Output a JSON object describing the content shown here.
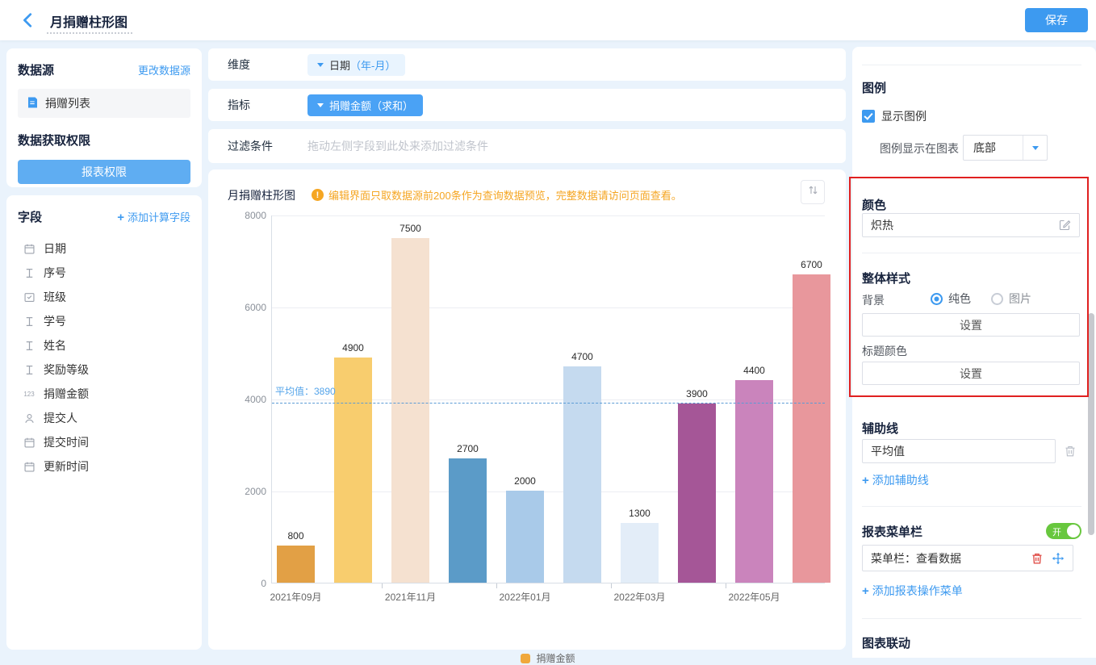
{
  "header": {
    "title": "月捐赠柱形图",
    "save_label": "保存"
  },
  "left_panel": {
    "datasource": {
      "title": "数据源",
      "change_link": "更改数据源",
      "name": "捐赠列表",
      "permission_title": "数据获取权限",
      "permission_button": "报表权限"
    },
    "fields": {
      "title": "字段",
      "add_link": "添加计算字段",
      "items": [
        {
          "icon": "calendar",
          "label": "日期"
        },
        {
          "icon": "text",
          "label": "序号"
        },
        {
          "icon": "select",
          "label": "班级"
        },
        {
          "icon": "text",
          "label": "学号"
        },
        {
          "icon": "text",
          "label": "姓名"
        },
        {
          "icon": "text",
          "label": "奖励等级"
        },
        {
          "icon": "number",
          "label": "捐赠金额"
        },
        {
          "icon": "person",
          "label": "提交人"
        },
        {
          "icon": "calendar",
          "label": "提交时间"
        },
        {
          "icon": "calendar",
          "label": "更新时间"
        }
      ]
    }
  },
  "config_rows": {
    "dimension": {
      "label": "维度",
      "pill_main": "日期",
      "pill_suffix": "（年-月）"
    },
    "metric": {
      "label": "指标",
      "pill": "捐赠金额（求和）"
    },
    "filter": {
      "label": "过滤条件",
      "placeholder": "拖动左侧字段到此处来添加过滤条件"
    }
  },
  "chart_card": {
    "title": "月捐赠柱形图",
    "warning": "编辑界面只取数据源前200条作为查询数据预览，完整数据请访问页面查看。"
  },
  "chart_data": {
    "type": "bar",
    "title": "月捐赠柱形图",
    "values": [
      800,
      4900,
      7500,
      2700,
      2000,
      4700,
      1300,
      3900,
      4400,
      6700
    ],
    "bar_colors": [
      "#E2A045",
      "#F8CD6E",
      "#F5E1D0",
      "#5B9BC8",
      "#A9CAE9",
      "#C5DAEF",
      "#E3EDF8",
      "#A55697",
      "#CA84BC",
      "#E8979C"
    ],
    "ylim": [
      0,
      8000
    ],
    "yticks": [
      0,
      2000,
      4000,
      6000,
      8000
    ],
    "x_tick_labels": [
      "2021年09月",
      "2021年11月",
      "2022年01月",
      "2022年03月",
      "2022年05月"
    ],
    "x_tick_bar_index": [
      0,
      2,
      4,
      6,
      8
    ],
    "average_line": {
      "value": 3890,
      "label": "平均值：3890"
    },
    "legend": [
      {
        "label": "捐赠金额",
        "color": "#F0A83C"
      }
    ],
    "legend_position": "bottom",
    "grid": true
  },
  "right_panel": {
    "legend_section": {
      "title": "图例",
      "show_label": "显示图例",
      "checked": true,
      "position_label": "图例显示在图表",
      "position_value": "底部"
    },
    "color_section": {
      "title": "颜色",
      "value": "炽热"
    },
    "style_section": {
      "title": "整体样式",
      "bg_label": "背景",
      "radio_solid": "纯色",
      "radio_image": "图片",
      "bg_button": "设置",
      "title_color_label": "标题颜色",
      "title_color_button": "设置"
    },
    "aux_line_section": {
      "title": "辅助线",
      "value": "平均值",
      "add_link": "添加辅助线"
    },
    "menu_section": {
      "title": "报表菜单栏",
      "toggle_label": "开",
      "item": "菜单栏：查看数据",
      "add_link": "添加报表操作菜单"
    },
    "linkage_section": {
      "title": "图表联动"
    },
    "accent_color": "#3D9AF0",
    "highlight_color": "#E02020"
  }
}
